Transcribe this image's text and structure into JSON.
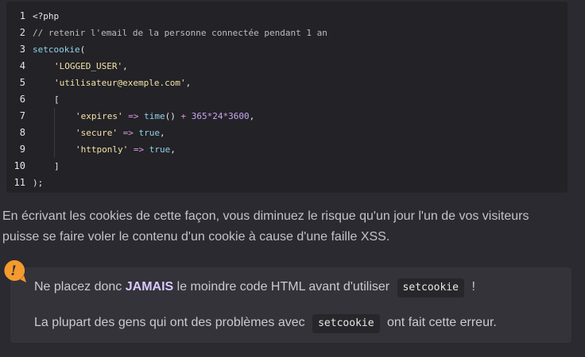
{
  "code": {
    "lines": [
      {
        "n": "1",
        "parts": [
          {
            "c": "kw",
            "t": "<?php"
          }
        ]
      },
      {
        "n": "2",
        "parts": [
          {
            "c": "cm",
            "t": "// retenir l'email de la personne connectée pendant 1 an"
          }
        ]
      },
      {
        "n": "3",
        "parts": [
          {
            "c": "fn",
            "t": "setcookie"
          },
          {
            "c": "plain",
            "t": "("
          }
        ]
      },
      {
        "n": "4",
        "indent": 1,
        "parts": [
          {
            "c": "str",
            "t": "'LOGGED_USER'"
          },
          {
            "c": "plain",
            "t": ","
          }
        ]
      },
      {
        "n": "5",
        "indent": 1,
        "parts": [
          {
            "c": "str",
            "t": "'utilisateur@exemple.com'"
          },
          {
            "c": "plain",
            "t": ","
          }
        ]
      },
      {
        "n": "6",
        "indent": 1,
        "parts": [
          {
            "c": "plain",
            "t": "["
          }
        ]
      },
      {
        "n": "7",
        "indent": 2,
        "parts": [
          {
            "c": "str",
            "t": "'expires'"
          },
          {
            "c": "op",
            "t": " => "
          },
          {
            "c": "fn",
            "t": "time"
          },
          {
            "c": "plain",
            "t": "()"
          },
          {
            "c": "op",
            "t": " + "
          },
          {
            "c": "num",
            "t": "365"
          },
          {
            "c": "op",
            "t": "*"
          },
          {
            "c": "num",
            "t": "24"
          },
          {
            "c": "op",
            "t": "*"
          },
          {
            "c": "num",
            "t": "3600"
          },
          {
            "c": "plain",
            "t": ","
          }
        ]
      },
      {
        "n": "8",
        "indent": 2,
        "parts": [
          {
            "c": "str",
            "t": "'secure'"
          },
          {
            "c": "op",
            "t": " => "
          },
          {
            "c": "fn",
            "t": "true"
          },
          {
            "c": "plain",
            "t": ","
          }
        ]
      },
      {
        "n": "9",
        "indent": 2,
        "parts": [
          {
            "c": "str",
            "t": "'httponly'"
          },
          {
            "c": "op",
            "t": " => "
          },
          {
            "c": "fn",
            "t": "true"
          },
          {
            "c": "plain",
            "t": ","
          }
        ]
      },
      {
        "n": "10",
        "indent": 1,
        "parts": [
          {
            "c": "plain",
            "t": "]"
          }
        ]
      },
      {
        "n": "11",
        "parts": [
          {
            "c": "plain",
            "t": ");"
          }
        ]
      }
    ]
  },
  "paragraph": {
    "line1": "En écrivant les cookies de cette façon, vous diminuez le risque qu'un jour l'un de vos visiteurs",
    "line2": "puisse se faire voler le contenu d'un cookie à cause d'une faille XSS."
  },
  "callout": {
    "icon": "exclamation-icon",
    "icon_color": "#f49a2e",
    "line1_before": "Ne placez donc ",
    "line1_strong": "JAMAIS",
    "line1_middle": " le moindre code HTML avant d'utiliser ",
    "line1_code": "setcookie",
    "line1_after": " !",
    "line2_before": "La plupart des gens qui ont des problèmes avec ",
    "line2_code": "setcookie",
    "line2_after": " ont fait cette erreur."
  }
}
